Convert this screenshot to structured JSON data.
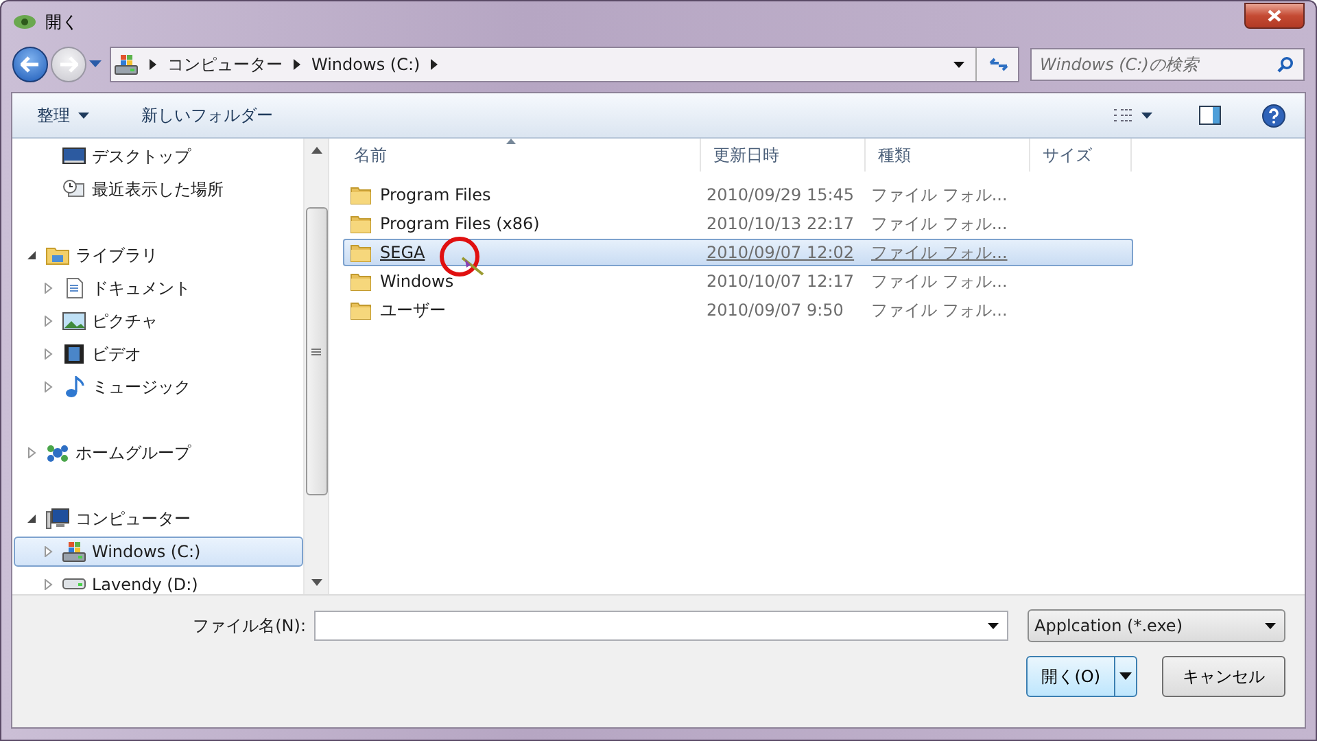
{
  "window": {
    "title": "開く"
  },
  "address": {
    "crumbs": [
      "コンピューター",
      "Windows (C:)"
    ]
  },
  "search": {
    "placeholder": "Windows (C:)の検索"
  },
  "toolbar": {
    "organize": "整理",
    "new_folder": "新しいフォルダー"
  },
  "sidebar": {
    "sections": [
      {
        "children": [
          {
            "label": "デスクトップ",
            "kind": "desktop",
            "selected": false
          },
          {
            "label": "最近表示した場所",
            "kind": "recent",
            "selected": false
          }
        ]
      },
      {
        "label": "ライブラリ",
        "kind": "library",
        "expanded": true,
        "selected": false,
        "children": [
          {
            "label": "ドキュメント",
            "kind": "documents",
            "expanded": false,
            "selected": false
          },
          {
            "label": "ピクチャ",
            "kind": "pictures",
            "expanded": false,
            "selected": false
          },
          {
            "label": "ビデオ",
            "kind": "video",
            "expanded": false,
            "selected": false
          },
          {
            "label": "ミュージック",
            "kind": "music",
            "expanded": false,
            "selected": false
          }
        ]
      },
      {
        "label": "ホームグループ",
        "kind": "homegroup",
        "expanded": false,
        "selected": false
      },
      {
        "label": "コンピューター",
        "kind": "computer",
        "expanded": true,
        "selected": false,
        "children": [
          {
            "label": "Windows (C:)",
            "kind": "system-drive",
            "expanded": false,
            "selected": true
          },
          {
            "label": "Lavendy (D:)",
            "kind": "drive",
            "expanded": false,
            "selected": false
          }
        ]
      }
    ]
  },
  "table": {
    "columns": [
      "名前",
      "更新日時",
      "種類",
      "サイズ"
    ],
    "rows": [
      {
        "name": "Program Files",
        "modified": "2010/09/29 15:45",
        "type": "ファイル フォル...",
        "selected": false
      },
      {
        "name": "Program Files (x86)",
        "modified": "2010/10/13 22:17",
        "type": "ファイル フォル...",
        "selected": false
      },
      {
        "name": "SEGA",
        "modified": "2010/09/07 12:02",
        "type": "ファイル フォル...",
        "selected": true
      },
      {
        "name": "Windows",
        "modified": "2010/10/07 12:17",
        "type": "ファイル フォル...",
        "selected": false
      },
      {
        "name": "ユーザー",
        "modified": "2010/09/07 9:50",
        "type": "ファイル フォル...",
        "selected": false
      }
    ]
  },
  "footer": {
    "filename_label": "ファイル名(N):",
    "filter": "Applcation (*.exe)",
    "open": "開く(O)",
    "cancel": "キャンセル"
  }
}
